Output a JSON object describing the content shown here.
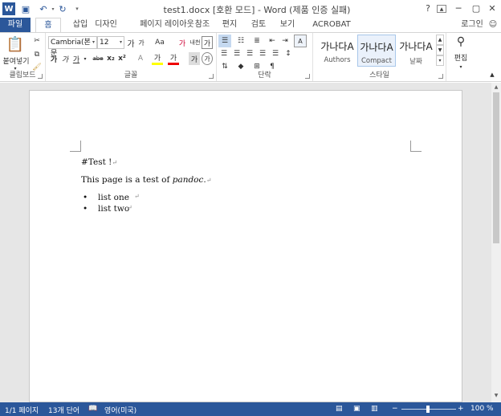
{
  "titlebar": {
    "title": "test1.docx [호환 모드] - Word (제품 인증 실패)",
    "app_icon": "W",
    "help": "?"
  },
  "tabs": [
    "파일",
    "홈",
    "삽입",
    "디자인",
    "페이지 레이아웃",
    "참조",
    "편지",
    "검토",
    "보기",
    "ACROBAT"
  ],
  "user": "로그인",
  "ribbon": {
    "clipboard": {
      "label": "클립보드",
      "paste": "붙여넣기"
    },
    "font": {
      "label": "글꼴",
      "font_name": "Cambria(본문",
      "font_size": "12",
      "grow": "가",
      "shrink": "가",
      "case": "Aa",
      "bold": "가",
      "italic": "가",
      "underline": "가",
      "strike": "abe",
      "sub": "x₂",
      "sup": "x²",
      "highlight": "가",
      "color": "가",
      "clear": "가",
      "phonetic": "내천",
      "border": "가",
      "enclose": "가"
    },
    "paragraph": {
      "label": "단락"
    },
    "styles": {
      "label": "스타일",
      "items": [
        {
          "sample": "가나다A",
          "name": "Authors"
        },
        {
          "sample": "가나다A",
          "name": "Compact"
        },
        {
          "sample": "가나다A",
          "name": "날짜"
        }
      ]
    },
    "editing": {
      "label": "편집"
    }
  },
  "document": {
    "line1": "#Test !",
    "line2_pre": "This page is a test of ",
    "line2_em": "pandoc",
    "line2_post": ".",
    "bullets": [
      "list one",
      "list two"
    ],
    "para_mark": "↵"
  },
  "status": {
    "page": "1/1 페이지",
    "words": "13개 단어",
    "lang": "영어(미국)",
    "zoom": "100 %"
  },
  "colors": {
    "accent": "#2b579a"
  }
}
